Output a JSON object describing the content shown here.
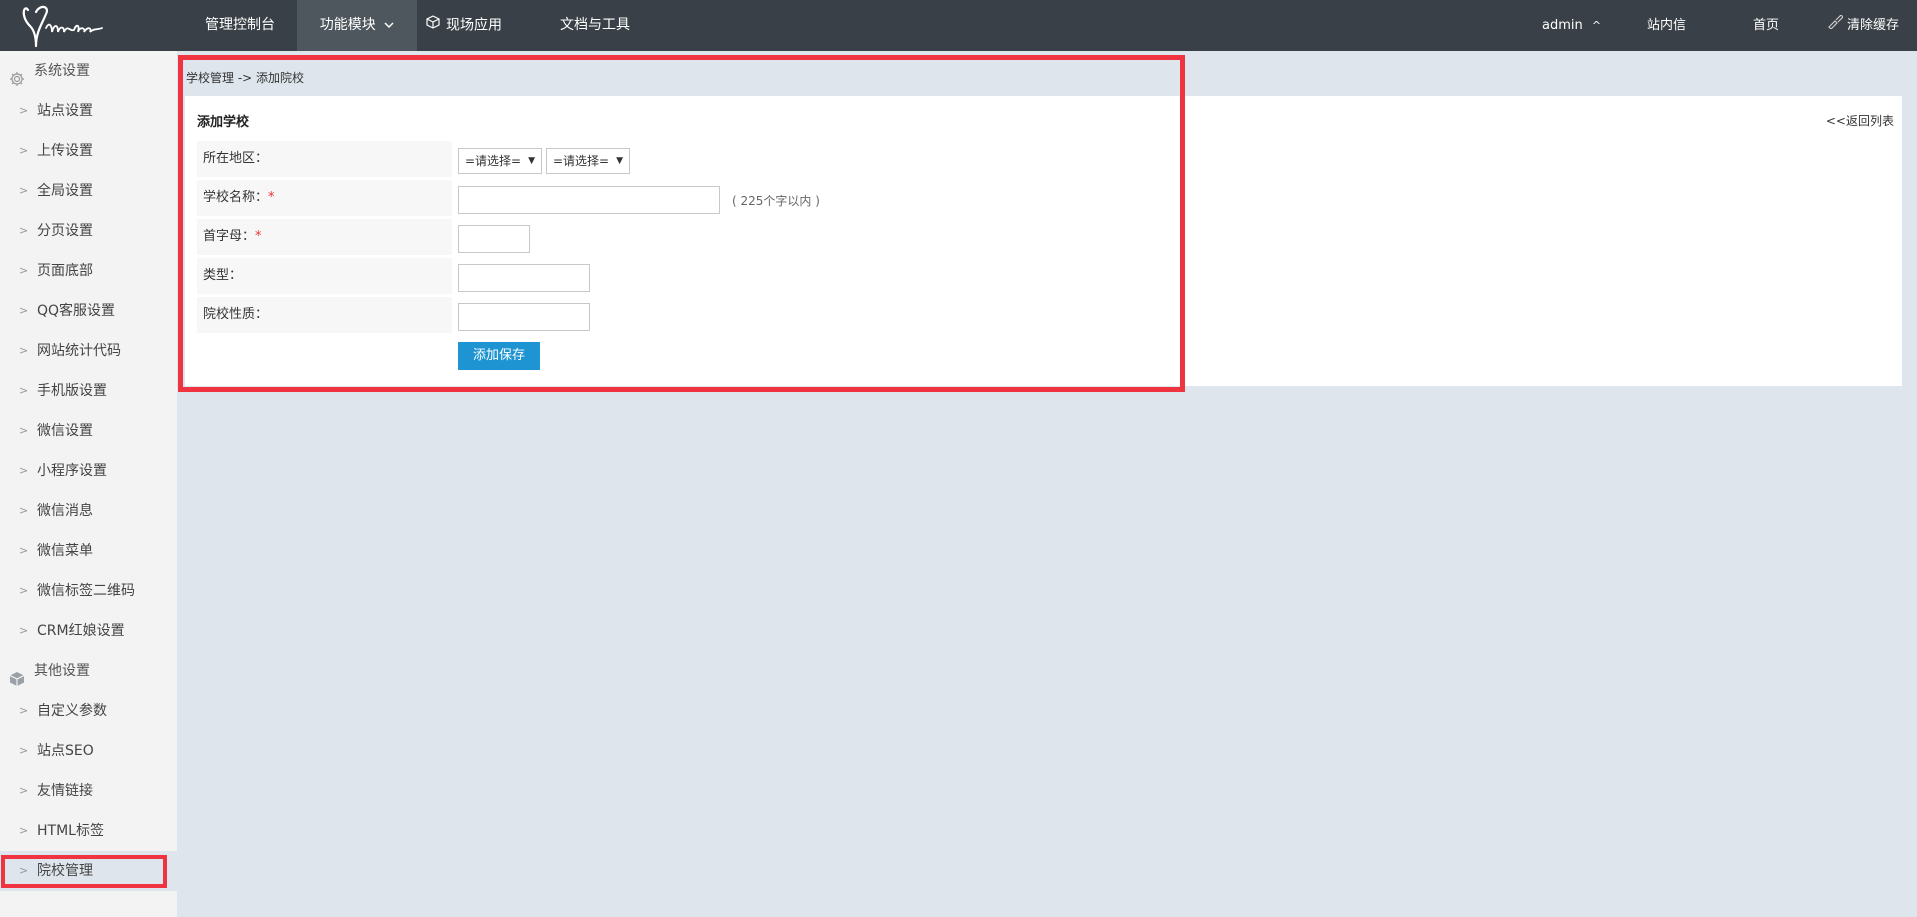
{
  "brand": {
    "logo_text": "Melone"
  },
  "topnav": {
    "items": [
      {
        "label": "管理控制台"
      },
      {
        "label": "功能模块"
      },
      {
        "label": "现场应用"
      },
      {
        "label": "文档与工具"
      }
    ],
    "right": {
      "user": "admin",
      "user_arrow": "^",
      "messages": "站内信",
      "home": "首页",
      "clear_cache": "清除缓存"
    }
  },
  "sidebar": {
    "groups": [
      {
        "label": "系统设置",
        "icon": "gear-icon",
        "items": [
          "站点设置",
          "上传设置",
          "全局设置",
          "分页设置",
          "页面底部",
          "QQ客服设置",
          "网站统计代码",
          "手机版设置",
          "微信设置",
          "小程序设置",
          "微信消息",
          "微信菜单",
          "微信标签二维码",
          "CRM红娘设置"
        ]
      },
      {
        "label": "其他设置",
        "icon": "cube-icon",
        "items": [
          "自定义参数",
          "站点SEO",
          "友情链接",
          "HTML标签",
          "院校管理"
        ]
      }
    ],
    "active_item": "院校管理"
  },
  "breadcrumb": {
    "text": "学校管理 -> 添加院校"
  },
  "panel": {
    "title": "添加学校",
    "back_link": "<<返回列表",
    "form": {
      "region": {
        "label": "所在地区：",
        "select1": "=请选择=",
        "select2": "=请选择="
      },
      "name": {
        "label": "学校名称：",
        "required": "*",
        "value": "",
        "hint": "( 225个字以内 )"
      },
      "initial": {
        "label": "首字母：",
        "required": "*",
        "value": ""
      },
      "type": {
        "label": "类型：",
        "value": ""
      },
      "nature": {
        "label": "院校性质：",
        "value": ""
      },
      "submit_label": "添加保存"
    }
  },
  "colors": {
    "topbar": "#3a4047",
    "accent": "#1e94d2",
    "highlight": "#ef3340",
    "page_bg": "#dee5ed"
  }
}
